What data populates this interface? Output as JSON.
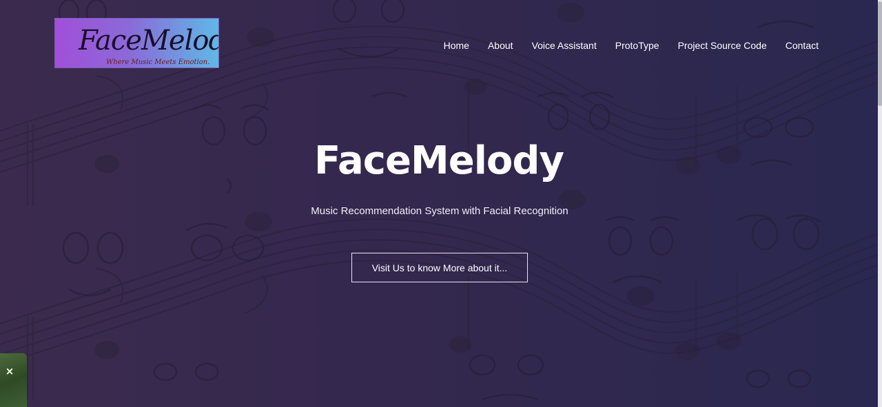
{
  "brand": {
    "logo_title": "FaceMelody",
    "logo_tagline": "Where Music Meets Emotion."
  },
  "nav": {
    "items": [
      {
        "label": "Home"
      },
      {
        "label": "About"
      },
      {
        "label": "Voice Assistant"
      },
      {
        "label": "ProtoType"
      },
      {
        "label": "Project Source Code"
      },
      {
        "label": "Contact"
      }
    ]
  },
  "hero": {
    "title": "FaceMelody",
    "subtitle": "Music Recommendation System with Facial Recognition",
    "cta_label": "Visit Us to know More about it..."
  },
  "floating_thumbnail": {
    "close_icon": "close-icon",
    "close_glyph": "×"
  },
  "colors": {
    "background": "#34284e",
    "text": "#ffffff",
    "button_border": "#e9e4f3"
  }
}
